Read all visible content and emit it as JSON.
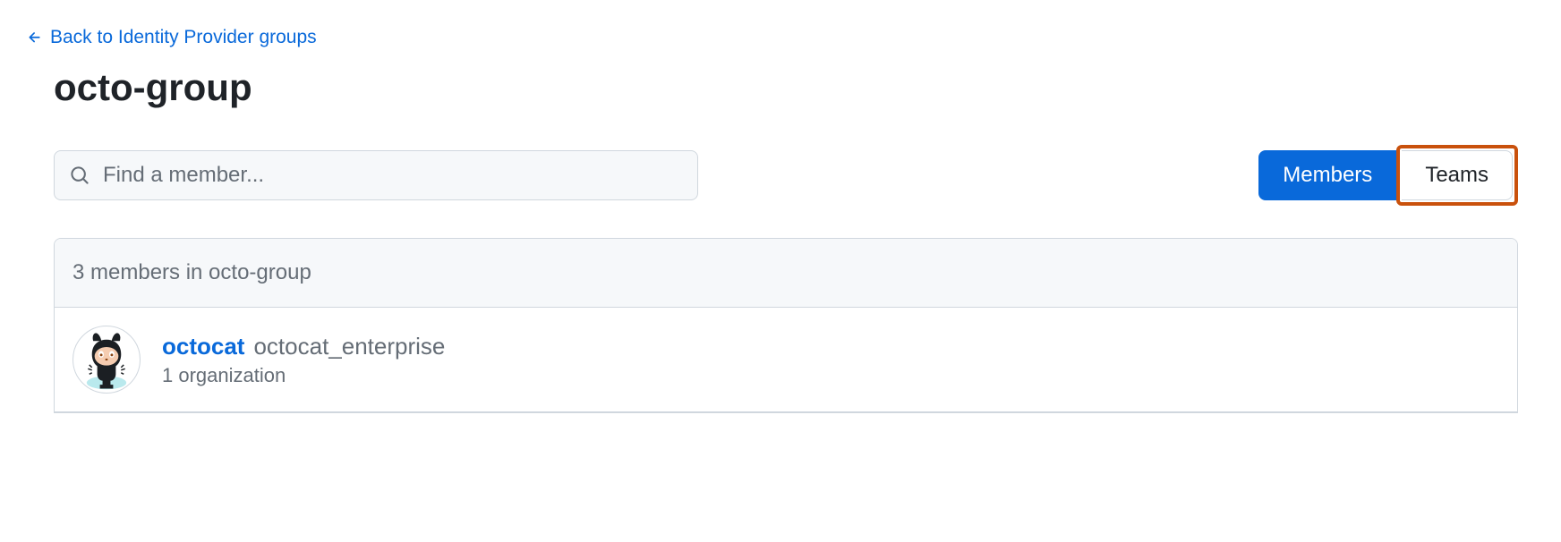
{
  "backLink": {
    "label": "Back to Identity Provider groups"
  },
  "page": {
    "title": "octo-group"
  },
  "search": {
    "placeholder": "Find a member..."
  },
  "tabs": {
    "members": "Members",
    "teams": "Teams"
  },
  "list": {
    "header": "3 members in octo-group",
    "items": [
      {
        "username": "octocat",
        "fullname": "octocat_enterprise",
        "meta": "1 organization"
      }
    ]
  }
}
